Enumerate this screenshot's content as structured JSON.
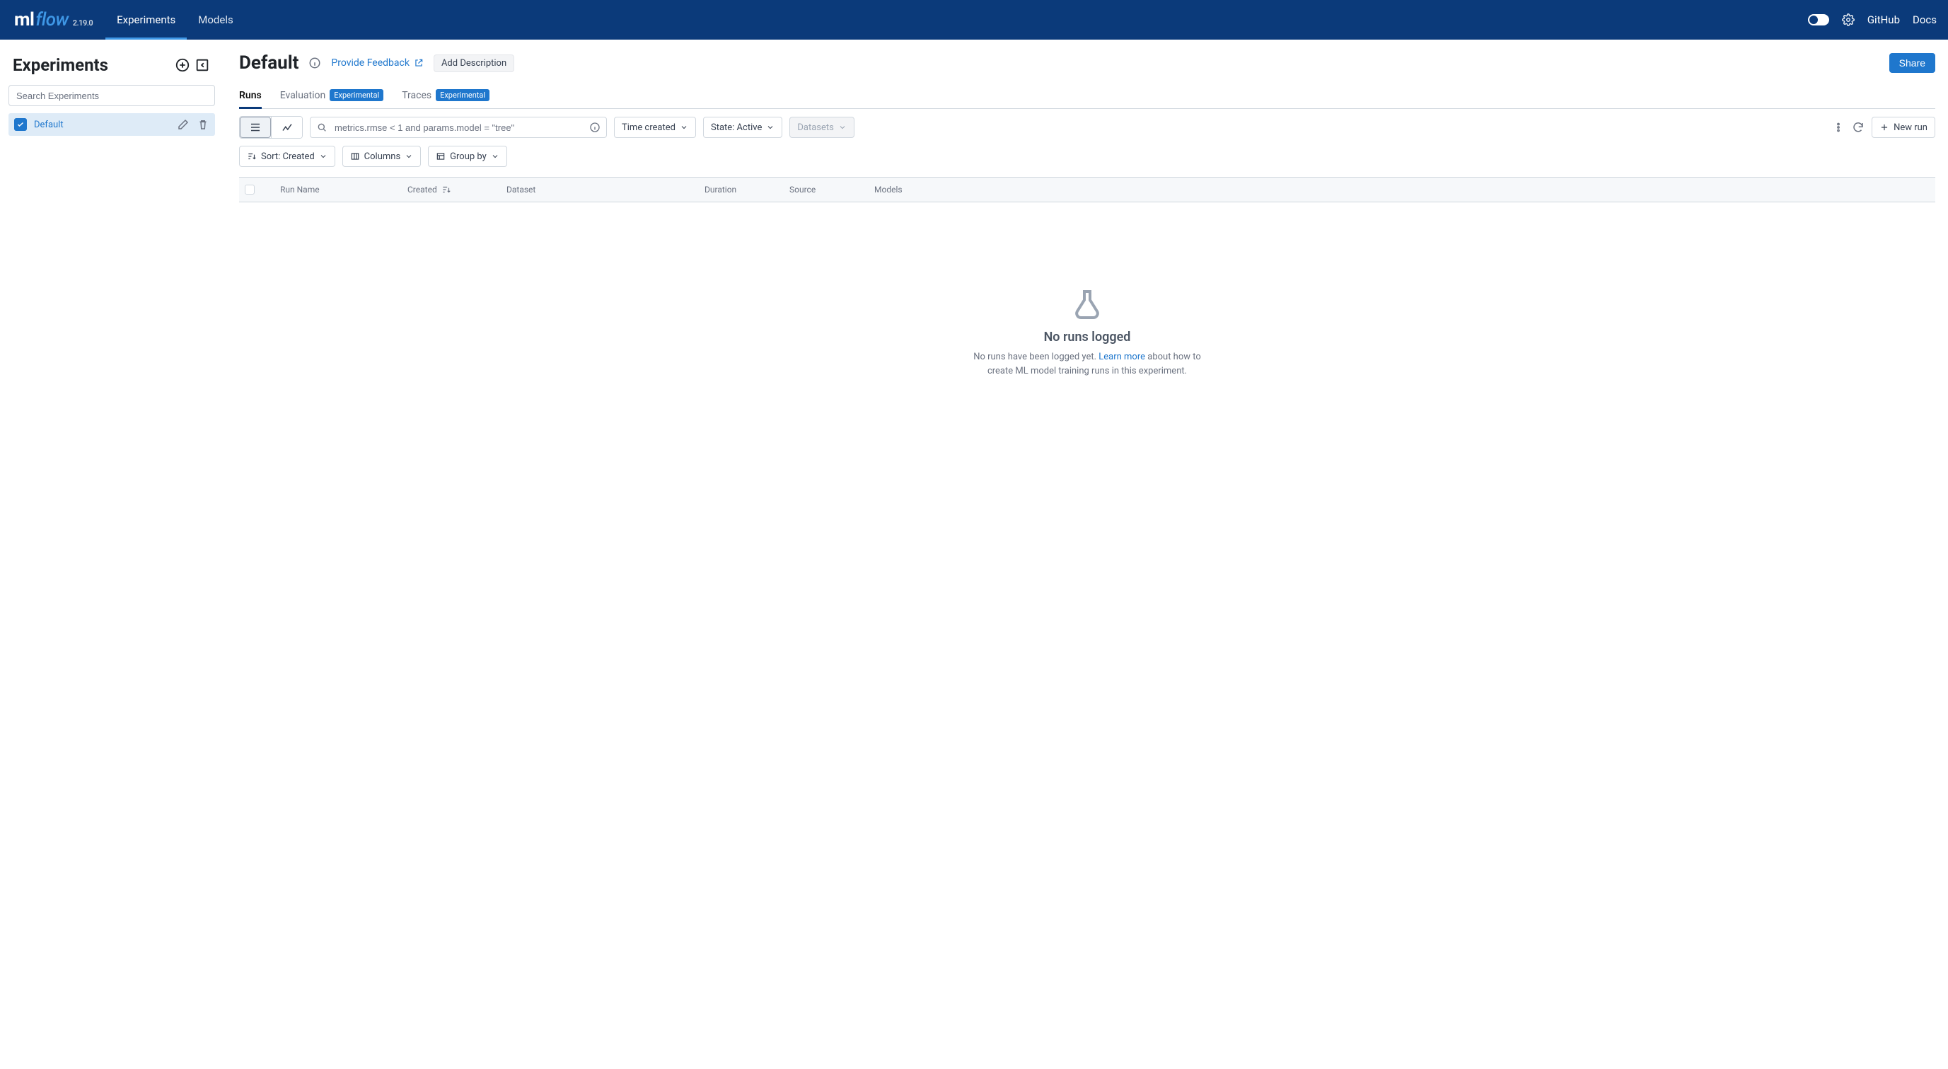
{
  "app": {
    "name_ml": "ml",
    "name_flow": "flow",
    "version": "2.19.0"
  },
  "nav": {
    "experiments": "Experiments",
    "models": "Models"
  },
  "top_links": {
    "github": "GitHub",
    "docs": "Docs"
  },
  "sidebar": {
    "title": "Experiments",
    "search_placeholder": "Search Experiments",
    "items": [
      {
        "label": "Default"
      }
    ]
  },
  "page": {
    "title": "Default",
    "feedback": "Provide Feedback",
    "add_description": "Add Description",
    "share": "Share"
  },
  "tabs": {
    "runs": "Runs",
    "evaluation": "Evaluation",
    "traces": "Traces",
    "experimental_badge": "Experimental"
  },
  "filterbar": {
    "search_placeholder": "metrics.rmse < 1 and params.model = \"tree\"",
    "time_created": "Time created",
    "state": "State: Active",
    "datasets": "Datasets",
    "new_run": "New run"
  },
  "filterbar2": {
    "sort": "Sort: Created",
    "columns": "Columns",
    "group_by": "Group by"
  },
  "table": {
    "cols": {
      "run_name": "Run Name",
      "created": "Created",
      "dataset": "Dataset",
      "duration": "Duration",
      "source": "Source",
      "models": "Models"
    }
  },
  "empty": {
    "title": "No runs logged",
    "before": "No runs have been logged yet. ",
    "link": "Learn more",
    "after": " about how to create ML model training runs in this experiment."
  }
}
